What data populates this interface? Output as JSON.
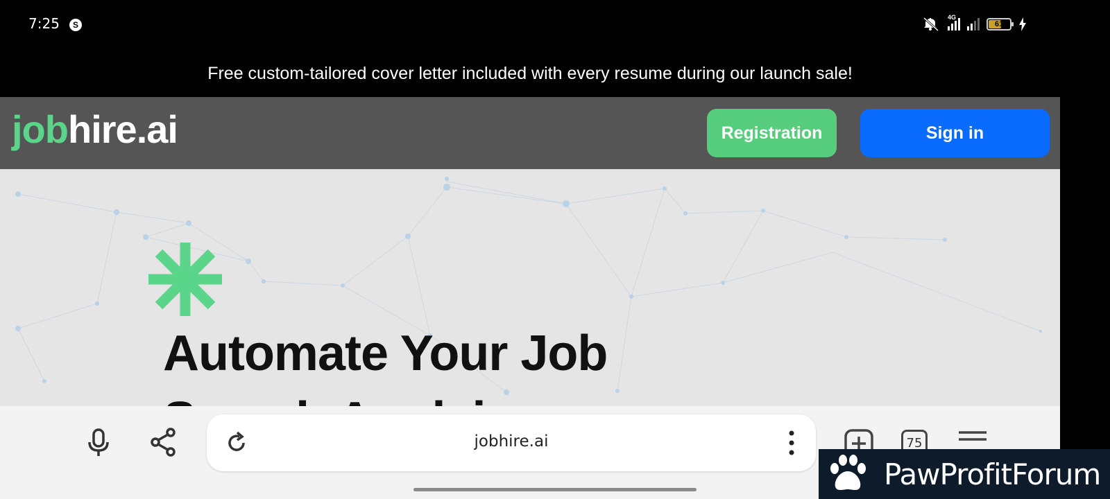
{
  "status_bar": {
    "time": "7:25",
    "app_badge": "S",
    "network_label": "4G",
    "battery_percent": "61",
    "battery_level": 0.61,
    "icons": [
      "mute-icon",
      "signal-icon",
      "battery-icon",
      "charging-icon"
    ]
  },
  "promo": {
    "text": "Free custom-tailored cover letter included with every resume during our launch sale!"
  },
  "header": {
    "logo_part1": "job",
    "logo_part2": "hire.ai",
    "registration_label": "Registration",
    "signin_label": "Sign in",
    "colors": {
      "header_bg": "#555555",
      "accent_green": "#55cd7c",
      "signin_blue": "#0a6bff"
    }
  },
  "hero": {
    "title_line1": "Automate Your Job",
    "title_line2": "Search Applying",
    "icons": [
      "asterisk-icon"
    ]
  },
  "browser": {
    "url": "jobhire.ai",
    "tab_count": "75",
    "icons": [
      "microphone-icon",
      "share-icon",
      "reload-icon",
      "more-vert-icon",
      "new-tab-icon",
      "tabs-icon",
      "menu-icon"
    ]
  },
  "watermark": {
    "text": "PawProfitForum"
  }
}
